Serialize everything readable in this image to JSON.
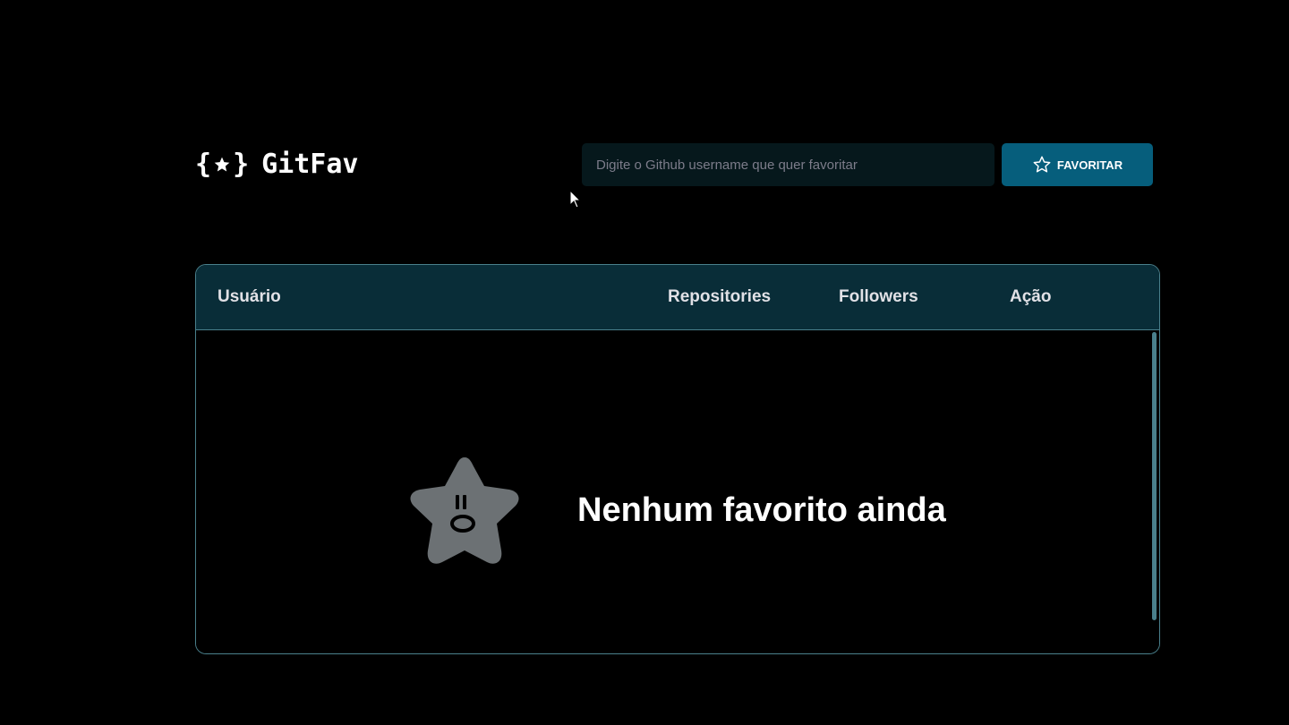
{
  "header": {
    "logo_text": "GitFav",
    "search_placeholder": "Digite o Github username que quer favoritar",
    "search_value": "",
    "favorite_button_label": "FAVORITAR"
  },
  "table": {
    "columns": [
      "Usuário",
      "Repositories",
      "Followers",
      "Ação"
    ],
    "rows": [],
    "empty_message": "Nenhum favorito ainda"
  },
  "icons": {
    "logo": "star-braces-icon",
    "favorite_button": "star-outline-icon",
    "empty_state": "star-face-icon",
    "cursor": "mouse-pointer-icon"
  },
  "colors": {
    "background": "#000000",
    "input_background": "#06181C",
    "button_background": "#065E7C",
    "table_header_background": "#092D38",
    "table_border": "#4A808C",
    "empty_star": "#6C7174",
    "text": "#E1E1E6"
  }
}
